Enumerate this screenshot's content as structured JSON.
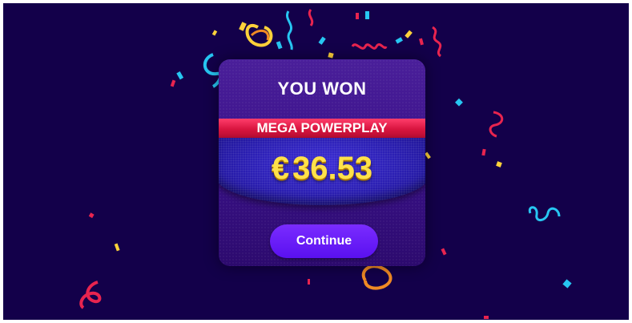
{
  "dialog": {
    "title": "YOU WON",
    "game_name": "MEGA POWERPLAY",
    "prize": {
      "currency_symbol": "€",
      "amount": "36.53"
    },
    "continue_label": "Continue"
  },
  "colors": {
    "background": "#13004a",
    "card": "#3b128a",
    "banner": "#d8153f",
    "prize_panel": "#2a1eb0",
    "amount_text": "#ffe14a",
    "button": "#5a10f0"
  },
  "decorations": {
    "confetti_colors": [
      "#ffd23a",
      "#27c6f2",
      "#e8244f",
      "#f08a24"
    ]
  }
}
